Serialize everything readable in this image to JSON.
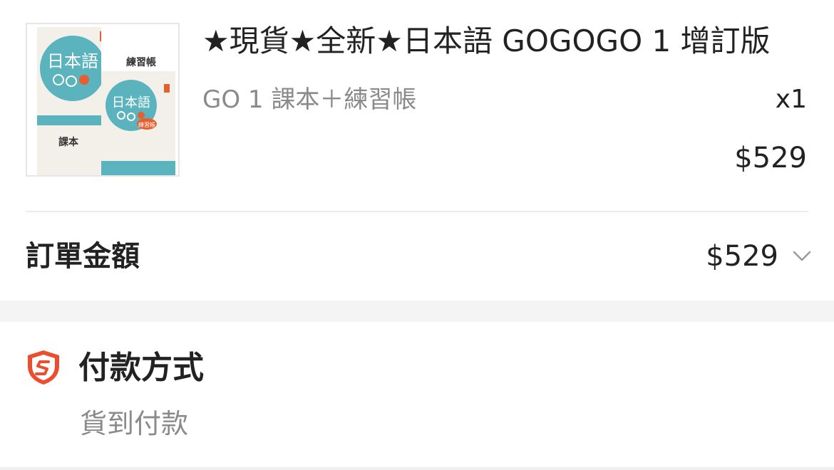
{
  "product": {
    "title": "★現貨★全新★日本語 GOGOGO 1 增訂版",
    "variant": "GO 1 課本＋練習帳",
    "quantity": "x1",
    "price": "$529",
    "image": {
      "cover_title": "日本語",
      "workbook_label": "練習帳",
      "textbook_label": "課本",
      "workbook_badge": "練習帳",
      "teal_color": "#5bb3bd",
      "orange_color": "#e4602f"
    }
  },
  "order_total": {
    "label": "訂單金額",
    "amount": "$529"
  },
  "payment": {
    "title": "付款方式",
    "method": "貨到付款",
    "icon_color": "#ee4d2d"
  }
}
